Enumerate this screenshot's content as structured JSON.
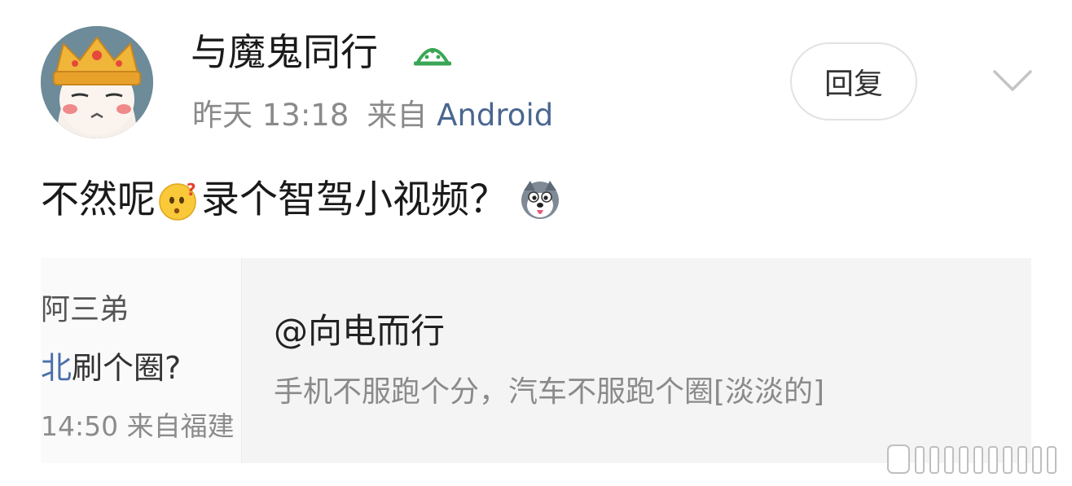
{
  "post": {
    "username": "与魔鬼同行",
    "timestamp": "昨天 13:18",
    "source_prefix": "来自",
    "source_device": "Android",
    "reply_label": "回复",
    "content_part1": "不然呢",
    "content_part2": "录个智驾小视频？",
    "emoji_1": "thinking-face-emoji",
    "emoji_2": "husky-dog-emoji",
    "badge_icon": "watermelon-icon",
    "more_icon": "chevron-down-icon"
  },
  "quote": {
    "thumb_line1": "阿三弟",
    "thumb_line2_highlight": "北",
    "thumb_line2_rest": "刷个圈?",
    "thumb_line3": "14:50 来自福建",
    "author": "@向电而行",
    "text": "手机不服跑个分，汽车不服跑个圈[淡淡的]"
  },
  "colors": {
    "link": "#4a6690",
    "meta_gray": "#8a8a8a",
    "badge_green": "#3aa655",
    "card_bg": "#f4f4f4"
  }
}
